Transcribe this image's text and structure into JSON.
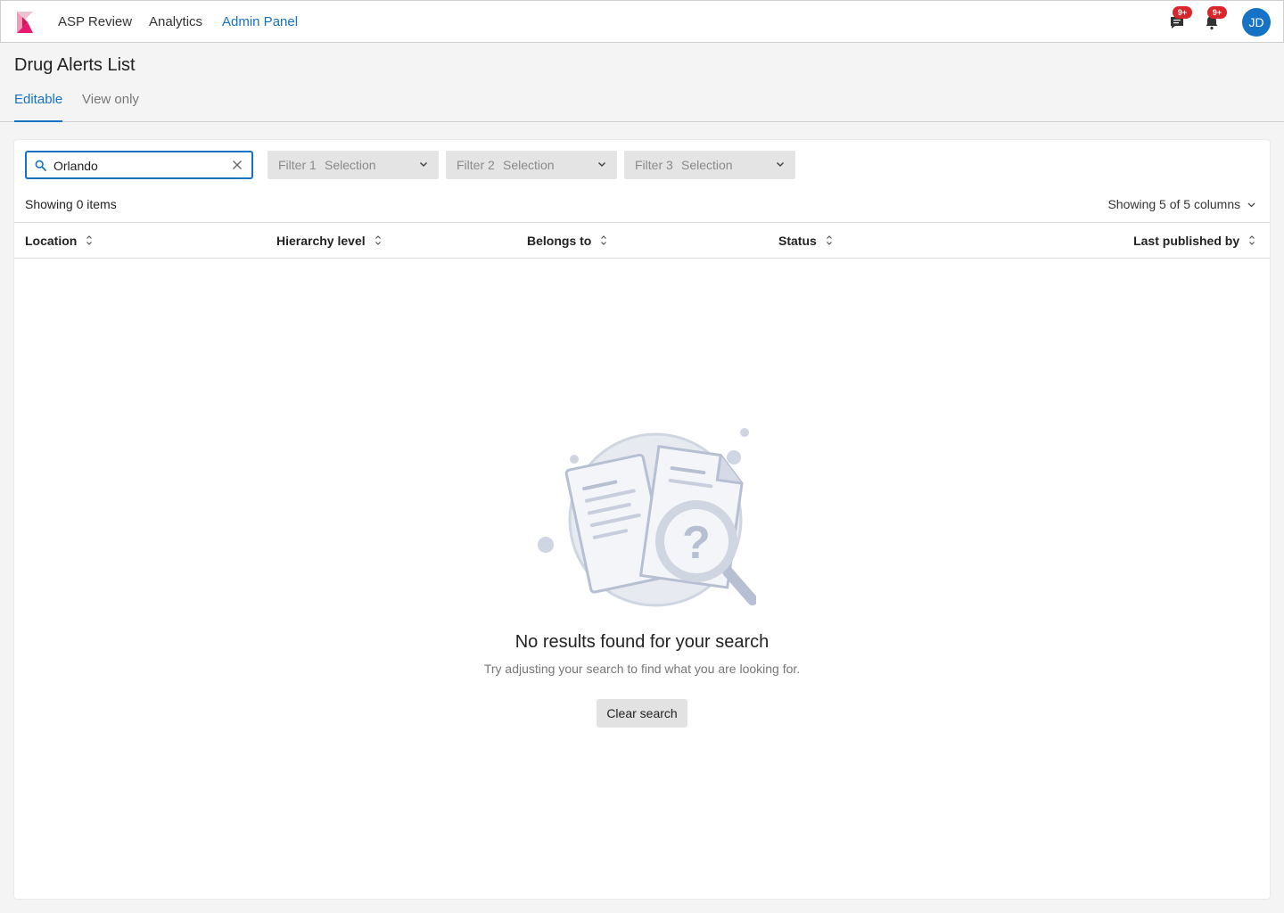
{
  "nav": {
    "links": [
      "ASP Review",
      "Analytics",
      "Admin Panel"
    ],
    "active_link": "Admin Panel",
    "messages_badge": "9+",
    "notifications_badge": "9+",
    "avatar_initials": "JD"
  },
  "page": {
    "title": "Drug Alerts List",
    "tabs": [
      "Editable",
      "View only"
    ],
    "active_tab": "Editable"
  },
  "toolbar": {
    "search_value": "Orlando",
    "filters": [
      {
        "label": "Filter 1",
        "value": "Selection"
      },
      {
        "label": "Filter 2",
        "value": "Selection"
      },
      {
        "label": "Filter 3",
        "value": "Selection"
      }
    ]
  },
  "table": {
    "count_text": "Showing 0 items",
    "columns_text": "Showing 5 of 5 columns",
    "columns": [
      "Location",
      "Hierarchy level",
      "Belongs to",
      "Status",
      "Last published by"
    ],
    "rows": []
  },
  "empty_state": {
    "title": "No results found for your search",
    "subtitle": "Try adjusting your search to find what you are looking for.",
    "button_label": "Clear search"
  },
  "colors": {
    "accent": "#1672c4",
    "badge": "#d8262b",
    "logo_pink": "#e8196e"
  }
}
